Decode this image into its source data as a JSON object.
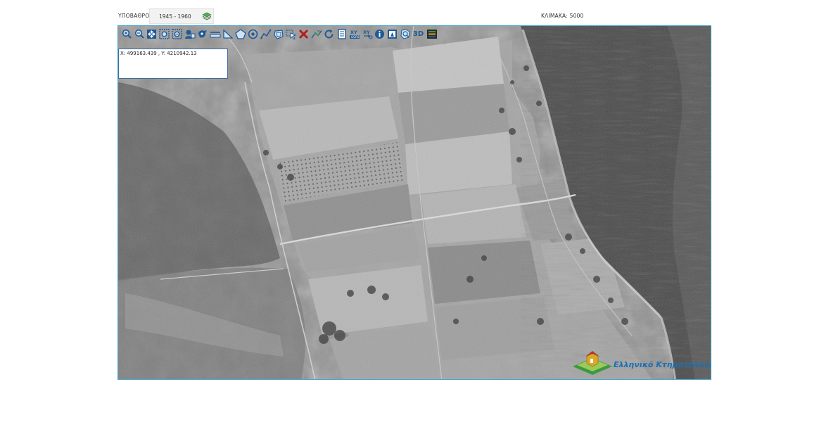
{
  "header": {
    "basemap_label": "ΥΠΟΒΑΘΡΟ:",
    "basemap_value": "1945 - 1960",
    "scale_label": "ΚΛΙΜΑΚΑ: 5000"
  },
  "coordinates": {
    "text": "X: 499163.439 , Y: 4210942.13"
  },
  "toolbar": {
    "tools": [
      "zoom-in-icon",
      "zoom-out-icon",
      "full-extent-icon",
      "zoom-box-icon",
      "zoom-previous-icon",
      "layers-icon",
      "identify-point-icon",
      "measure-distance-icon",
      "measure-angle-icon",
      "polygon-icon",
      "target-icon",
      "polyline-icon",
      "draw-shape-icon",
      "select-icon",
      "delete-icon",
      "coordinates-icon",
      "refresh-icon",
      "report-icon",
      "xy-input-icon",
      "xy-transform-icon",
      "info-icon",
      "print-map-icon",
      "search-location-icon",
      "3d-view-icon",
      "legend-icon"
    ],
    "label_3d": "3D"
  },
  "logo": {
    "text": "Ελληνικό Κτηματολόγιο"
  },
  "colors": {
    "frame_border": "#3fa3c9",
    "logo_blue": "#1a6fb5",
    "logo_green": "#3c9a3c",
    "logo_gold": "#d8a82a"
  }
}
